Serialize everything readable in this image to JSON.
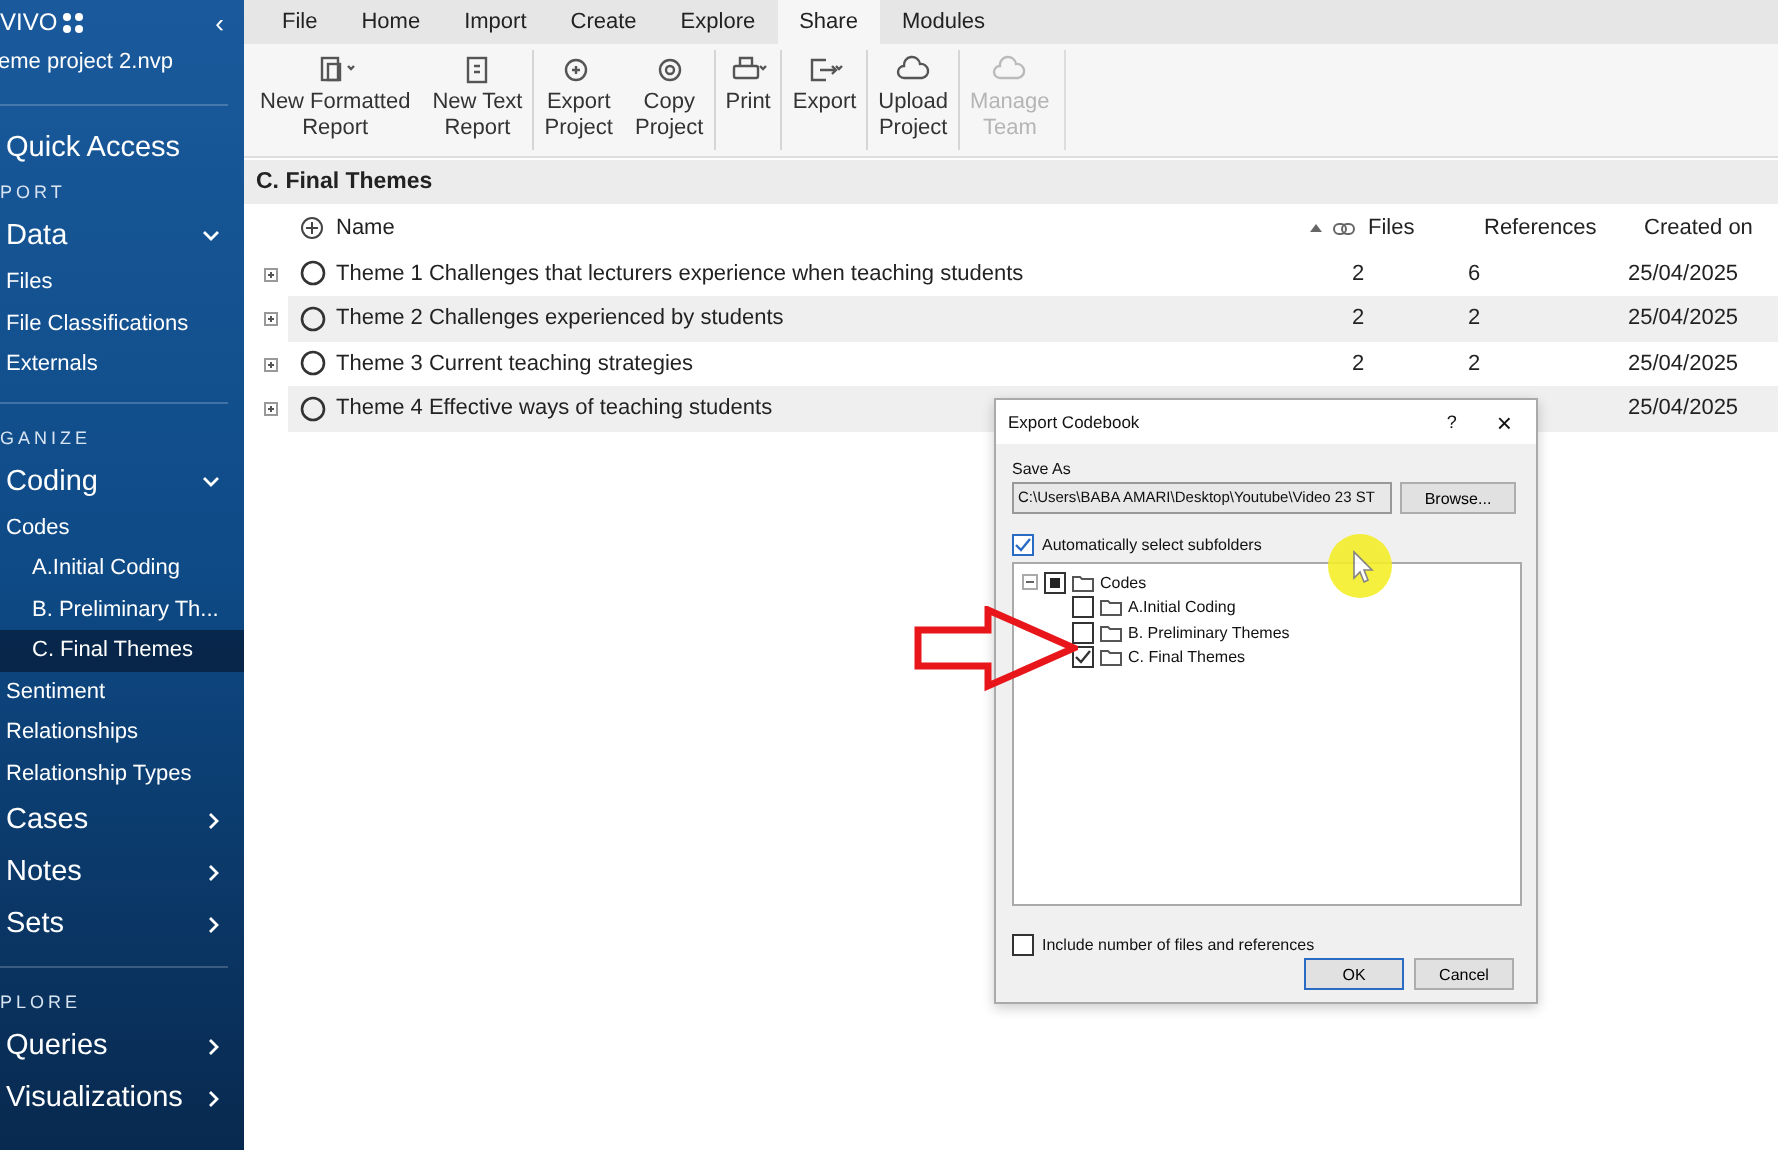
{
  "sidebar": {
    "app_title": "VIVO",
    "project": "eme project 2.nvp",
    "collapse_glyph": "‹",
    "items": [
      {
        "kind": "big",
        "label": "Quick Access",
        "selected": false
      },
      {
        "kind": "section",
        "label": "PORT"
      },
      {
        "kind": "big",
        "label": "Data",
        "expanded": true,
        "selected": false
      },
      {
        "kind": "small",
        "label": "Files",
        "selected": false
      },
      {
        "kind": "small",
        "label": "File Classifications",
        "selected": false
      },
      {
        "kind": "small",
        "label": "Externals",
        "selected": false
      },
      {
        "kind": "section",
        "label": "GANIZE"
      },
      {
        "kind": "big",
        "label": "Coding",
        "expanded": true,
        "selected": false
      },
      {
        "kind": "small",
        "label": "Codes",
        "selected": false
      },
      {
        "kind": "sub",
        "label": "A.Initial Coding",
        "selected": false
      },
      {
        "kind": "sub",
        "label": "B. Preliminary Th...",
        "selected": false
      },
      {
        "kind": "sub",
        "label": "C. Final Themes",
        "selected": true
      },
      {
        "kind": "small",
        "label": "Sentiment",
        "selected": false
      },
      {
        "kind": "small",
        "label": "Relationships",
        "selected": false
      },
      {
        "kind": "small",
        "label": "Relationship Types",
        "selected": false
      },
      {
        "kind": "big",
        "label": "Cases",
        "expanded": false,
        "selected": false
      },
      {
        "kind": "big",
        "label": "Notes",
        "expanded": false,
        "selected": false
      },
      {
        "kind": "big",
        "label": "Sets",
        "expanded": false,
        "selected": false
      },
      {
        "kind": "section",
        "label": "PLORE"
      },
      {
        "kind": "big",
        "label": "Queries",
        "expanded": false,
        "selected": false
      },
      {
        "kind": "big",
        "label": "Visualizations",
        "expanded": false,
        "selected": false
      }
    ]
  },
  "tabs": [
    {
      "label": "File",
      "selected": false
    },
    {
      "label": "Home",
      "selected": false
    },
    {
      "label": "Import",
      "selected": false
    },
    {
      "label": "Create",
      "selected": false
    },
    {
      "label": "Explore",
      "selected": false
    },
    {
      "label": "Share",
      "selected": true
    },
    {
      "label": "Modules",
      "selected": false
    }
  ],
  "ribbon": [
    {
      "lines": [
        "New Formatted",
        "Report"
      ],
      "dropdown": true,
      "disabled": false
    },
    {
      "group_start": false,
      "lines": [
        "New Text",
        "Report"
      ],
      "dropdown": false,
      "disabled": false
    },
    {
      "group_start": true,
      "lines": [
        "Export",
        "Project"
      ],
      "dropdown": false,
      "disabled": false
    },
    {
      "group_start": false,
      "lines": [
        "Copy",
        "Project"
      ],
      "dropdown": false,
      "disabled": false
    },
    {
      "group_start": true,
      "lines": [
        "Print"
      ],
      "dropdown": true,
      "disabled": false
    },
    {
      "group_start": true,
      "lines": [
        "Export"
      ],
      "dropdown": true,
      "disabled": false
    },
    {
      "group_start": true,
      "lines": [
        "Upload",
        "Project"
      ],
      "dropdown": false,
      "disabled": false
    },
    {
      "group_start": true,
      "lines": [
        "Manage",
        "Team"
      ],
      "dropdown": false,
      "disabled": true
    }
  ],
  "view_title": "C. Final Themes",
  "table": {
    "columns": [
      "Name",
      "Files",
      "References",
      "Created on"
    ],
    "rows": [
      {
        "name": "Theme 1  Challenges that lecturers experience when teaching students",
        "files": "2",
        "references": "6",
        "created": "25/04/2025"
      },
      {
        "name": "Theme 2 Challenges experienced by students",
        "files": "2",
        "references": "2",
        "created": "25/04/2025"
      },
      {
        "name": "Theme 3 Current teaching strategies",
        "files": "2",
        "references": "2",
        "created": "25/04/2025"
      },
      {
        "name": "Theme 4 Effective ways of teaching students",
        "created": "25/04/2025"
      }
    ]
  },
  "dialog": {
    "title": "Export Codebook",
    "help_glyph": "?",
    "close_glyph": "×",
    "save_as_label": "Save As",
    "path": "C:\\Users\\BABA  AMARI\\Desktop\\Youtube\\Video 23 ST",
    "browse": "Browse...",
    "auto_select": {
      "label": "Automatically select subfolders",
      "checked": true
    },
    "tree": [
      {
        "label": "Codes",
        "partial": true,
        "children": [
          {
            "label": "A.Initial Coding",
            "checked": false
          },
          {
            "label": "B. Preliminary Themes",
            "checked": false
          },
          {
            "label": "C. Final Themes",
            "checked": true
          }
        ]
      }
    ],
    "include_counts": {
      "label": "Include number of files and references",
      "checked": false
    },
    "buttons": [
      "OK",
      "Cancel"
    ]
  }
}
